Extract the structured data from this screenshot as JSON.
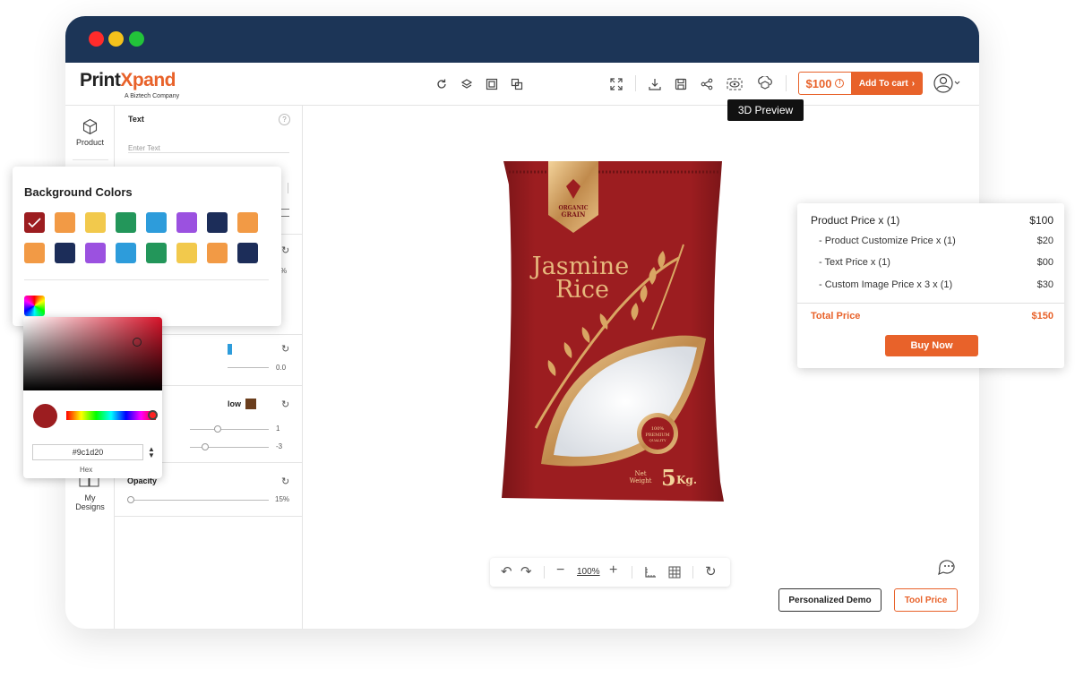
{
  "brand": {
    "name_part1": "Print",
    "name_part2": "Xpand",
    "tagline": "A Biztech Company"
  },
  "header": {
    "price": "$100",
    "add_to_cart": "Add To cart",
    "tooltip": "3D Preview"
  },
  "sidebar": {
    "items": [
      {
        "label": "Product",
        "icon": "cube-icon"
      },
      {
        "label": "My Designs",
        "label_line1": "My",
        "label_line2": "Designs",
        "icon": "designs-icon"
      }
    ]
  },
  "panel": {
    "text_section": {
      "title": "Text",
      "placeholder": "Enter Text"
    },
    "slider_value_a": "0.0",
    "shadow_label": "low",
    "shadow_value_1": "1",
    "shadow_value_2": "-3",
    "opacity": {
      "label": "Opacity",
      "value": "15%"
    },
    "partial_percent": "%"
  },
  "background_colors": {
    "title": "Background Colors",
    "row1": [
      "#9c1d20",
      "#f29a45",
      "#f2c94c",
      "#23965a",
      "#2d9cdb",
      "#9b51e0",
      "#1c2d59",
      "#f29a45"
    ],
    "row2": [
      "#f29a45",
      "#1c2d59",
      "#9b51e0",
      "#2d9cdb",
      "#23965a",
      "#f2c94c",
      "#f29a45",
      "#1c2d59"
    ],
    "selected_index": 0
  },
  "color_picker": {
    "hex": "#9c1d20",
    "hex_label": "Hex",
    "current_color": "#9c1d20"
  },
  "product": {
    "badge_line1": "ORGANIC",
    "badge_line2": "GRAIN",
    "name_line1": "Jasmine",
    "name_line2": "Rice",
    "seal_line1": "100%",
    "seal_line2": "PREMIUM",
    "seal_line3": "QUALITY",
    "net_label_1": "Net",
    "net_label_2": "Weight",
    "weight_number": "5",
    "weight_unit": "Kg.",
    "bag_color": "#9c1d20"
  },
  "canvas_toolbar": {
    "zoom": "100%"
  },
  "footer_buttons": {
    "demo": "Personalized Demo",
    "tool_price": "Tool Price"
  },
  "price_card": {
    "product_price_label": "Product Price  x  (1)",
    "product_price_value": "$100",
    "lines": [
      {
        "label": "- Product Customize Price  x  (1)",
        "value": "$20"
      },
      {
        "label": "- Text Price x (1)",
        "value": "$00"
      },
      {
        "label": "- Custom Image Price x 3 x  (1)",
        "value": "$30"
      }
    ],
    "total_label": "Total Price",
    "total_value": "$150",
    "buy_now": "Buy Now"
  },
  "colors": {
    "accent": "#e8622a",
    "titlebar": "#1c3557"
  }
}
